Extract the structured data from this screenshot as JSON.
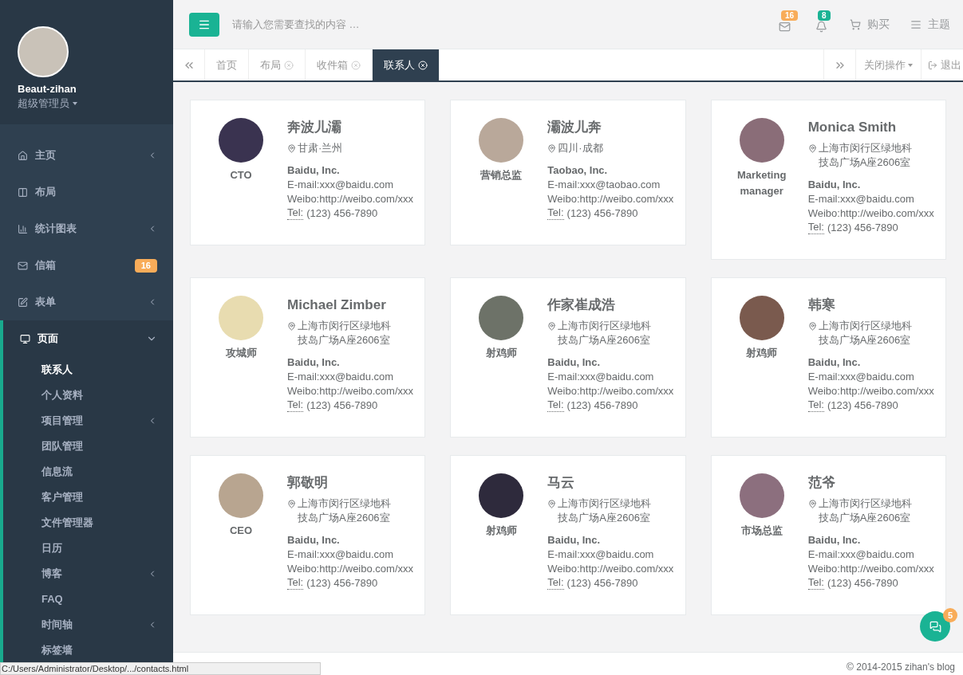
{
  "sidebar": {
    "profile": {
      "name": "Beaut-zihan",
      "role": "超级管理员"
    },
    "items": [
      {
        "kind": "home",
        "label": "主页",
        "has_submenu": true,
        "expanded": false
      },
      {
        "kind": "layout",
        "label": "布局",
        "expanded": false
      },
      {
        "kind": "chart",
        "label": "统计图表",
        "has_submenu": true,
        "expanded": false
      },
      {
        "kind": "mail",
        "label": "信箱",
        "badge": "16",
        "expanded": false
      },
      {
        "kind": "form",
        "label": "表单",
        "has_submenu": true,
        "expanded": false
      },
      {
        "kind": "page",
        "label": "页面",
        "has_submenu": true,
        "expanded": true,
        "children": [
          {
            "label": "联系人",
            "selected": true
          },
          {
            "label": "个人资料",
            "selected": false
          },
          {
            "label": "项目管理",
            "selected": false,
            "has_submenu": true
          },
          {
            "label": "团队管理",
            "selected": false
          },
          {
            "label": "信息流",
            "selected": false
          },
          {
            "label": "客户管理",
            "selected": false
          },
          {
            "label": "文件管理器",
            "selected": false
          },
          {
            "label": "日历",
            "selected": false
          },
          {
            "label": "博客",
            "selected": false,
            "has_submenu": true
          },
          {
            "label": "FAQ",
            "selected": false
          },
          {
            "label": "时间轴",
            "selected": false,
            "has_submenu": true
          },
          {
            "label": "标签墙",
            "selected": false
          }
        ]
      }
    ]
  },
  "top_bar": {
    "search": {
      "placeholder": "请输入您需要查找的内容 …"
    },
    "notifications": [
      {
        "kind": "mail",
        "badge": "16",
        "color": "#f8ac59"
      },
      {
        "kind": "bell",
        "badge": "8",
        "color": "#1ab394"
      }
    ],
    "links": [
      {
        "kind": "cart",
        "label": "购买"
      },
      {
        "kind": "theme",
        "label": "主题"
      }
    ]
  },
  "tabs": [
    {
      "label": "首页",
      "closable": false,
      "selected": false
    },
    {
      "label": "布局",
      "closable": true,
      "selected": false
    },
    {
      "label": "收件箱",
      "closable": true,
      "selected": false
    },
    {
      "label": "联系人",
      "closable": true,
      "selected": true
    }
  ],
  "tab_actions": {
    "close_menu": "关闭操作",
    "logout": "退出"
  },
  "contacts": [
    {
      "name": "奔波儿灞",
      "title": "CTO",
      "address": "甘肃·兰州",
      "company": "Baidu, Inc.",
      "email": "E-mail:xxx@baidu.com",
      "weibo": "Weibo:http://weibo.com/xxx",
      "tel_label": "Tel:",
      "tel": "(123) 456-7890"
    },
    {
      "name": "灞波儿奔",
      "title": "营销总监",
      "address": "四川·成都",
      "company": "Taobao, Inc.",
      "email": "E-mail:xxx@taobao.com",
      "weibo": "Weibo:http://weibo.com/xxx",
      "tel_label": "Tel:",
      "tel": "(123) 456-7890"
    },
    {
      "name": "Monica Smith",
      "title": "Marketing manager",
      "address": "上海市闵行区绿地科技岛广场A座2606室",
      "company": "Baidu, Inc.",
      "email": "E-mail:xxx@baidu.com",
      "weibo": "Weibo:http://weibo.com/xxx",
      "tel_label": "Tel:",
      "tel": "(123) 456-7890"
    },
    {
      "name": "Michael Zimber",
      "title": "攻城师",
      "address": "上海市闵行区绿地科技岛广场A座2606室",
      "company": "Baidu, Inc.",
      "email": "E-mail:xxx@baidu.com",
      "weibo": "Weibo:http://weibo.com/xxx",
      "tel_label": "Tel:",
      "tel": "(123) 456-7890"
    },
    {
      "name": "作家崔成浩",
      "title": "射鸡师",
      "address": "上海市闵行区绿地科技岛广场A座2606室",
      "company": "Baidu, Inc.",
      "email": "E-mail:xxx@baidu.com",
      "weibo": "Weibo:http://weibo.com/xxx",
      "tel_label": "Tel:",
      "tel": "(123) 456-7890"
    },
    {
      "name": "韩寒",
      "title": "射鸡师",
      "address": "上海市闵行区绿地科技岛广场A座2606室",
      "company": "Baidu, Inc.",
      "email": "E-mail:xxx@baidu.com",
      "weibo": "Weibo:http://weibo.com/xxx",
      "tel_label": "Tel:",
      "tel": "(123) 456-7890"
    },
    {
      "name": "郭敬明",
      "title": "CEO",
      "address": "上海市闵行区绿地科技岛广场A座2606室",
      "company": "Baidu, Inc.",
      "email": "E-mail:xxx@baidu.com",
      "weibo": "Weibo:http://weibo.com/xxx",
      "tel_label": "Tel:",
      "tel": "(123) 456-7890"
    },
    {
      "name": "马云",
      "title": "射鸡师",
      "address": "上海市闵行区绿地科技岛广场A座2606室",
      "company": "Baidu, Inc.",
      "email": "E-mail:xxx@baidu.com",
      "weibo": "Weibo:http://weibo.com/xxx",
      "tel_label": "Tel:",
      "tel": "(123) 456-7890"
    },
    {
      "name": "范爷",
      "title": "市场总监",
      "address": "上海市闵行区绿地科技岛广场A座2606室",
      "company": "Baidu, Inc.",
      "email": "E-mail:xxx@baidu.com",
      "weibo": "Weibo:http://weibo.com/xxx",
      "tel_label": "Tel:",
      "tel": "(123) 456-7890"
    }
  ],
  "chat_button": {
    "badge": "5"
  },
  "footer": {
    "copyright": "© 2014-2015 zihan's blog"
  },
  "status_bar": {
    "url": "C:/Users/Administrator/Desktop/.../contacts.html"
  }
}
